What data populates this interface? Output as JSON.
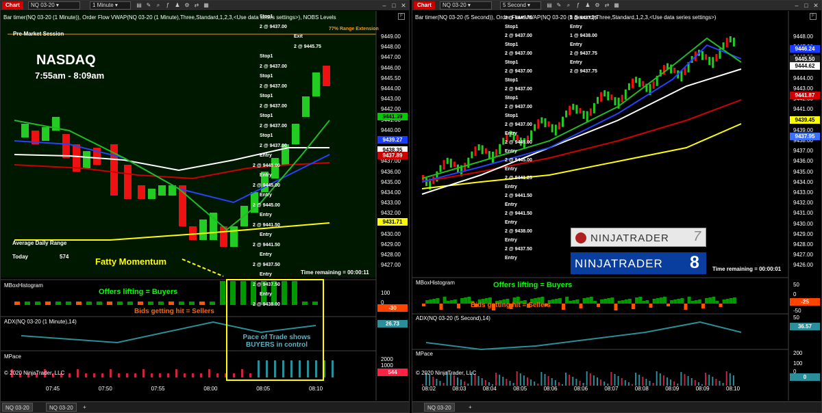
{
  "left": {
    "chart_tab": "Chart",
    "instrument": "NQ 03-20",
    "interval": "1 Minute",
    "title": "Bar timer(NQ 03-20 (1 Minute)), Order Flow VWAP(NQ 03-20 (1 Minute),Three,Standard,1,2,3,<Use data series settings>), NOBS Levels",
    "range_ext": "77% Range Extension",
    "premarket": "Pre-Market Session",
    "nasdaq": "NASDAQ",
    "time_range": "7:55am - 8:09am",
    "adr_label": "Average Daily Range",
    "today_label": "Today",
    "today_value": "574",
    "fatty": "Fatty Momentum",
    "time_remaining": "Time remaining = 00:00:11",
    "mbox_title": "MBoxHistogram",
    "offers": "Offers lifting = Buyers",
    "bids": "Bids getting hit = Sellers",
    "adx_title": "ADX(NQ 03-20 (1 Minute),14)",
    "pace_text_1": "Pace of Trade shows",
    "pace_text_2": "BUYERS in control",
    "mpace_title": "MPace",
    "copyright": "© 2020 NinjaTrader, LLC",
    "price_axis": [
      "9449.00",
      "9448.00",
      "9447.00",
      "9446.00",
      "9445.50",
      "9444.00",
      "9443.00",
      "9442.00",
      "9441.00",
      "9440.00",
      "9439.00",
      "9438.00",
      "9437.00",
      "9436.00",
      "9435.00",
      "9434.00",
      "9433.00",
      "9432.00",
      "9431.00",
      "9430.00",
      "9429.00",
      "9428.00",
      "9427.00"
    ],
    "tags": [
      {
        "value": "9441.39",
        "color": "#00cc00",
        "fg": "#000"
      },
      {
        "value": "9439.27",
        "color": "#1a3cff",
        "fg": "#fff"
      },
      {
        "value": "9438.35",
        "color": "#ffffff",
        "fg": "#000"
      },
      {
        "value": "9437.89",
        "color": "#d00000",
        "fg": "#fff"
      },
      {
        "value": "9431.71",
        "color": "#ffff00",
        "fg": "#000"
      }
    ],
    "mbox_axis": [
      "100",
      "0"
    ],
    "mbox_tag": "-30",
    "adx_tag": "26.73",
    "mpace_axis": [
      "2000",
      "1000"
    ],
    "mpace_tag": "544",
    "time_axis": [
      "07:45",
      "07:50",
      "07:55",
      "08:00",
      "08:05",
      "08:10"
    ],
    "tab_1": "NQ 03-20",
    "tab_2": "NQ 03-20",
    "add_tab": "+",
    "annotations": [
      "Stop1",
      "2 @ 9437.00",
      "Exit",
      "2 @ 9445.75",
      "Stop1",
      "2 @ 9437.00",
      "Stop1",
      "2 @ 9437.00",
      "Stop1",
      "2 @ 9437.00",
      "Stop1",
      "2 @ 9437.00",
      "Stop1",
      "2 @ 9437.00",
      "Entry",
      "2 @ 9445.00",
      "Entry",
      "2 @ 9445.00",
      "Entry",
      "2 @ 9445.00",
      "Entry",
      "2 @ 9441.50",
      "Entry",
      "2 @ 9441.50",
      "Entry",
      "2 @ 9437.50",
      "Entry",
      "2 @ 9437.50",
      "Entry",
      "2 @ 9438.00"
    ]
  },
  "right": {
    "chart_tab": "Chart",
    "instrument": "NQ 03-20",
    "interval": "5 Second",
    "title": "Bar timer(NQ 03-20 (5 Second)), Order Flow VWAP(NQ 03-20 (5 Second),Three,Standard,1,2,3,<Use data series settings>)",
    "logo_7": "NINJATRADER",
    "logo_8": "NINJATRADER",
    "logo_8_num": "8",
    "logo_7_num": "7",
    "time_remaining": "Time remaining = 00:00:01",
    "mbox_title": "MBoxHistogram",
    "offers": "Offers lifting = Buyers",
    "bids": "Bids getting hit = Sellers",
    "adx_title": "ADX(NQ 03-20 (5 Second),14)",
    "mpace_title": "MPace",
    "copyright": "© 2020 NinjaTrader, LLC",
    "price_axis": [
      "9448.00",
      "9447.00",
      "9446.00",
      "9445.00",
      "9444.00",
      "9443.00",
      "9442.00",
      "9441.00",
      "9440.00",
      "9439.00",
      "9438.00",
      "9437.00",
      "9436.00",
      "9435.00",
      "9434.00",
      "9433.00",
      "9432.00",
      "9431.00",
      "9430.00",
      "9429.00",
      "9428.00",
      "9427.00",
      "9426.00"
    ],
    "tags": [
      {
        "value": "9446.24",
        "color": "#1a3cff",
        "fg": "#fff"
      },
      {
        "value": "9445.50",
        "color": "#222",
        "fg": "#fff"
      },
      {
        "value": "9444.62",
        "color": "#ffffff",
        "fg": "#000"
      },
      {
        "value": "9441.87",
        "color": "#d00000",
        "fg": "#fff"
      },
      {
        "value": "9439.45",
        "color": "#ffff00",
        "fg": "#000"
      },
      {
        "value": "9437.95",
        "color": "#3b6fff",
        "fg": "#fff"
      }
    ],
    "mbox_axis": [
      "50",
      "0",
      "-50"
    ],
    "mbox_tag": "-25",
    "adx_axis": [
      "50"
    ],
    "adx_tag": "36.57",
    "mpace_axis": [
      "200",
      "100",
      "0"
    ],
    "mpace_tag": "0",
    "time_axis": [
      "08:02",
      "08:03",
      "08:04",
      "08:05",
      "08:06",
      "08:06",
      "08:07",
      "08:08",
      "08:09",
      "08:09",
      "08:10"
    ],
    "tab_1": "NQ 03-20",
    "add_tab": "+",
    "annotations": [
      "2 @ 9445.75",
      "Stop1",
      "2 @ 9437.00",
      "Stop1",
      "2 @ 9437.00",
      "Stop1",
      "2 @ 9437.00",
      "Stop1",
      "2 @ 9437.00",
      "Stop1",
      "2 @ 9437.00",
      "Stop1",
      "2 @ 9437.00",
      "Entry",
      "2 @ 9445.00",
      "Entry",
      "2 @ 9445.00",
      "Entry",
      "2 @ 9441.25",
      "Entry",
      "2 @ 9441.50",
      "Entry",
      "2 @ 9441.50",
      "Entry",
      "2 @ 9438.00",
      "Entry",
      "2 @ 9437.50",
      "Entry",
      "2 @ 9437.75",
      "Entry",
      "1 @ 9438.00",
      "Entry",
      "2 @ 9437.75",
      "Entry",
      "2 @ 9437.75"
    ]
  }
}
